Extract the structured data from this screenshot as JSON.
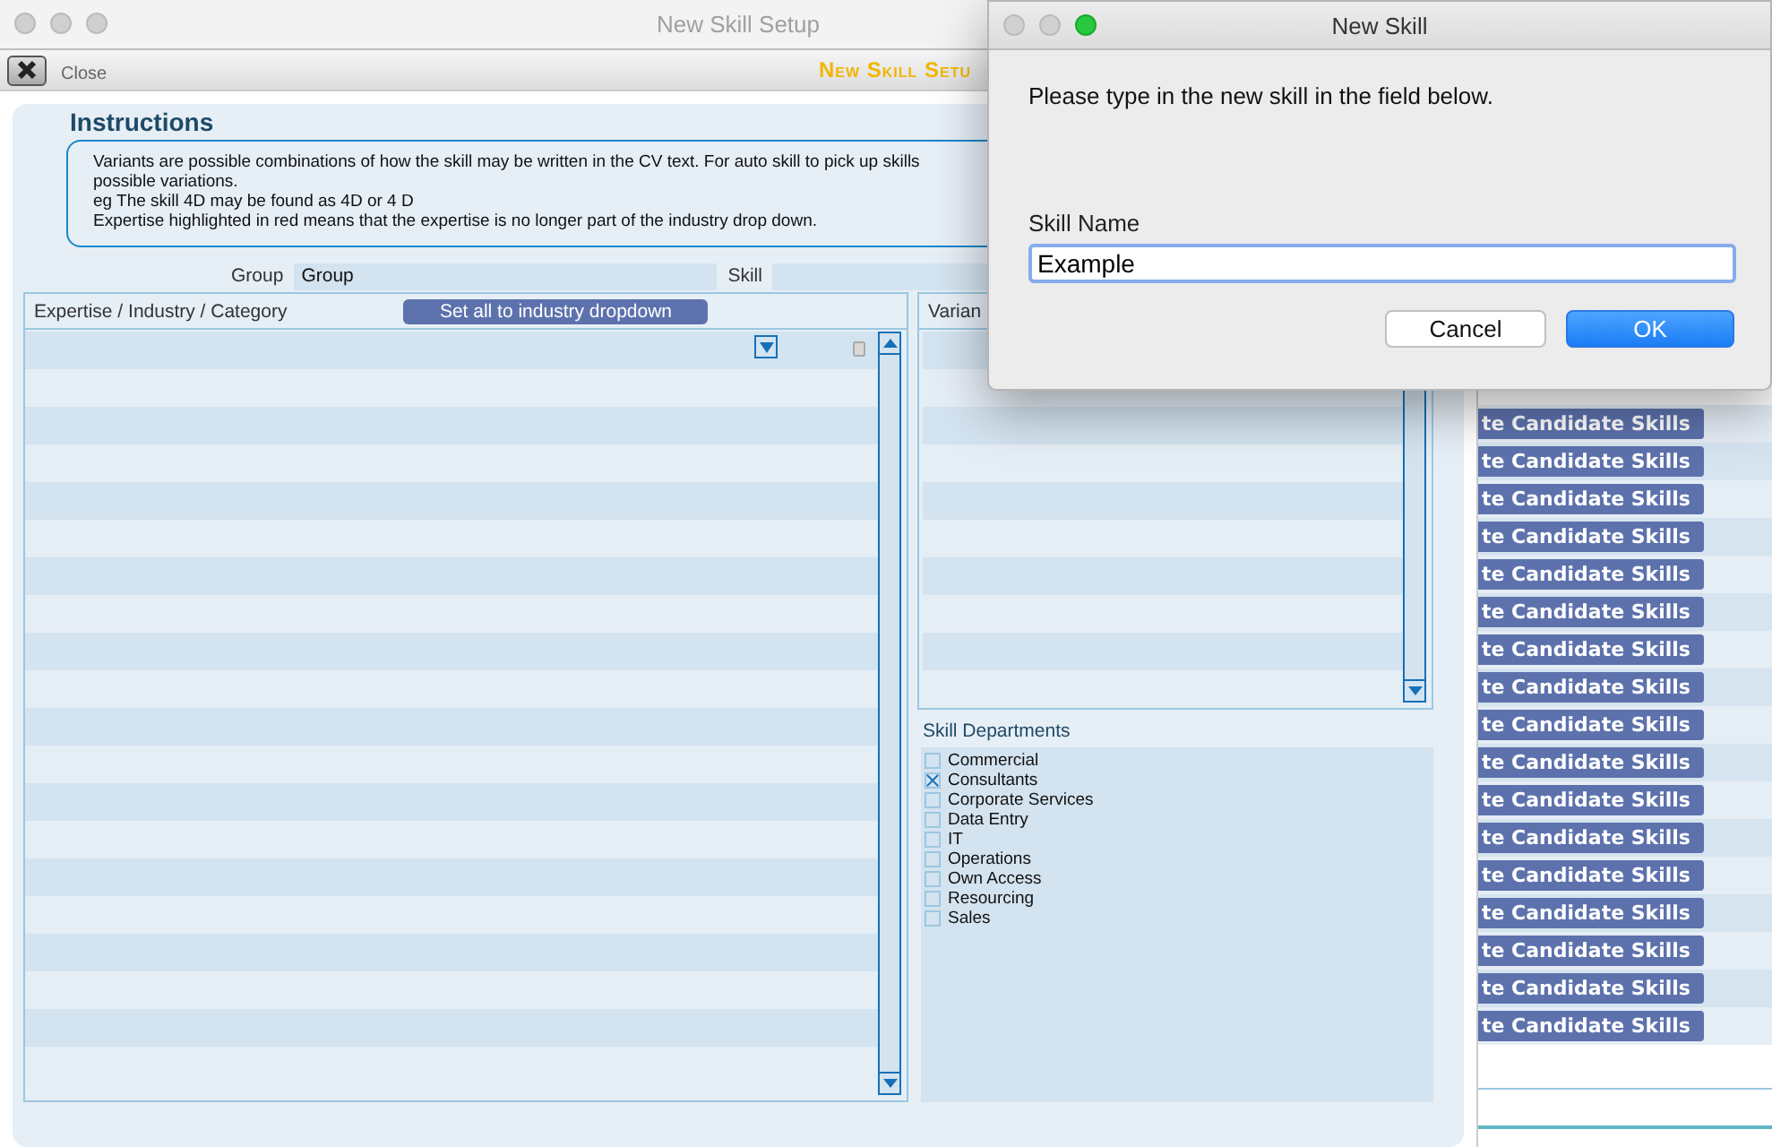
{
  "back_window": {
    "title": "New Skill Setup",
    "close_label": "Close",
    "banner": "New Skill Setu"
  },
  "instructions": {
    "heading": "Instructions",
    "lines": [
      "Variants are possible combinations of how the skill may be written in the CV text. For auto skill to pick up skills",
      "possible variations.",
      "eg The skill 4D may be found as 4D or 4 D",
      "Expertise highlighted in red means that the expertise is no longer part of the industry drop down."
    ]
  },
  "group": {
    "label": "Group",
    "value": "Group"
  },
  "skill": {
    "label": "Skill"
  },
  "expertise": {
    "header": "Expertise / Industry / Category",
    "button": "Set all to industry dropdown"
  },
  "variants": {
    "header": "Varian"
  },
  "skill_departments": {
    "title": "Skill Departments",
    "items": [
      {
        "label": "Commercial",
        "checked": false
      },
      {
        "label": "Consultants",
        "checked": true
      },
      {
        "label": "Corporate Services",
        "checked": false
      },
      {
        "label": "Data Entry",
        "checked": false
      },
      {
        "label": "IT",
        "checked": false
      },
      {
        "label": "Operations",
        "checked": false
      },
      {
        "label": "Own Access",
        "checked": false
      },
      {
        "label": "Resourcing",
        "checked": false
      },
      {
        "label": "Sales",
        "checked": false
      }
    ]
  },
  "candidate_skill_buttons": [
    "te Candidate Skills",
    "te Candidate Skills",
    "te Candidate Skills",
    "te Candidate Skills",
    "te Candidate Skills",
    "te Candidate Skills",
    "te Candidate Skills",
    "te Candidate Skills",
    "te Candidate Skills",
    "te Candidate Skills",
    "te Candidate Skills",
    "te Candidate Skills",
    "te Candidate Skills",
    "te Candidate Skills",
    "te Candidate Skills",
    "te Candidate Skills",
    "te Candidate Skills"
  ],
  "dialog": {
    "title": "New Skill",
    "message": "Please type in the new skill in the field below.",
    "field_label": "Skill Name",
    "field_value": "Example",
    "buttons": [
      {
        "label": "Cancel",
        "default": false
      },
      {
        "label": "OK",
        "default": true
      }
    ]
  }
}
